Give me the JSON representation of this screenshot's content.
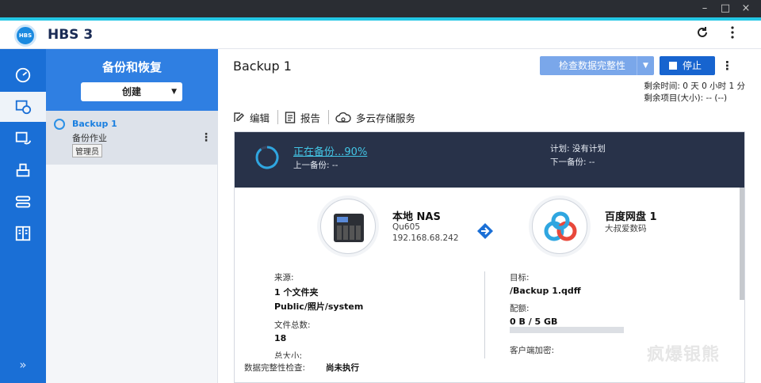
{
  "app": {
    "title": "HBS 3",
    "logo_text": "HBS"
  },
  "window_controls": [
    "–",
    "□",
    "×"
  ],
  "rail": {
    "items": [
      {
        "icon": "dashboard-icon"
      },
      {
        "icon": "backup-restore-icon",
        "active": true
      },
      {
        "icon": "sync-icon"
      },
      {
        "icon": "storage-icon"
      },
      {
        "icon": "services-icon"
      },
      {
        "icon": "logs-icon"
      }
    ],
    "expand": "»"
  },
  "joblist": {
    "title": "备份和恢复",
    "create_label": "创建",
    "job": {
      "name": "Backup 1",
      "type": "备份作业",
      "owner": "管理员"
    }
  },
  "main": {
    "title": "Backup 1",
    "check_label": "检查数据完整性",
    "stop_label": "停止",
    "remaining_time": "剩余时间: 0 天 0 小时 1 分",
    "remaining_items": "剩余项目(大小): -- (--)",
    "toolbar": {
      "edit": "编辑",
      "report": "报告",
      "multicloud": "多云存储服务"
    },
    "status": {
      "text": "正在备份...90%",
      "progress": 0.9,
      "last_backup": "上一备份: --",
      "plan": "计划: 没有计划",
      "next_backup": "下一备份: --"
    },
    "source_node": {
      "name": "本地 NAS",
      "model": "Qu605",
      "ip": "192.168.68.242"
    },
    "dest_node": {
      "name": "百度网盘 1",
      "account": "大叔爱数码"
    },
    "details": {
      "source_label": "来源:",
      "source_count": "1 个文件夹",
      "source_path": "Public/照片/system",
      "total_files_label": "文件总数:",
      "total_files": "18",
      "total_size_label": "总大小:",
      "target_label": "目标:",
      "target_value": "/Backup 1.qdff",
      "quota_label": "配额:",
      "quota_value": "0 B / 5 GB",
      "quota_used": 0,
      "encryption_label": "客户端加密:"
    },
    "integrity": {
      "label": "数据完整性检查:",
      "value": "尚未执行"
    }
  },
  "watermark": "疯爆银熊",
  "colors": {
    "accent": "#1a6fd6",
    "status_bg": "#283249",
    "status_text": "#43c6e6"
  }
}
